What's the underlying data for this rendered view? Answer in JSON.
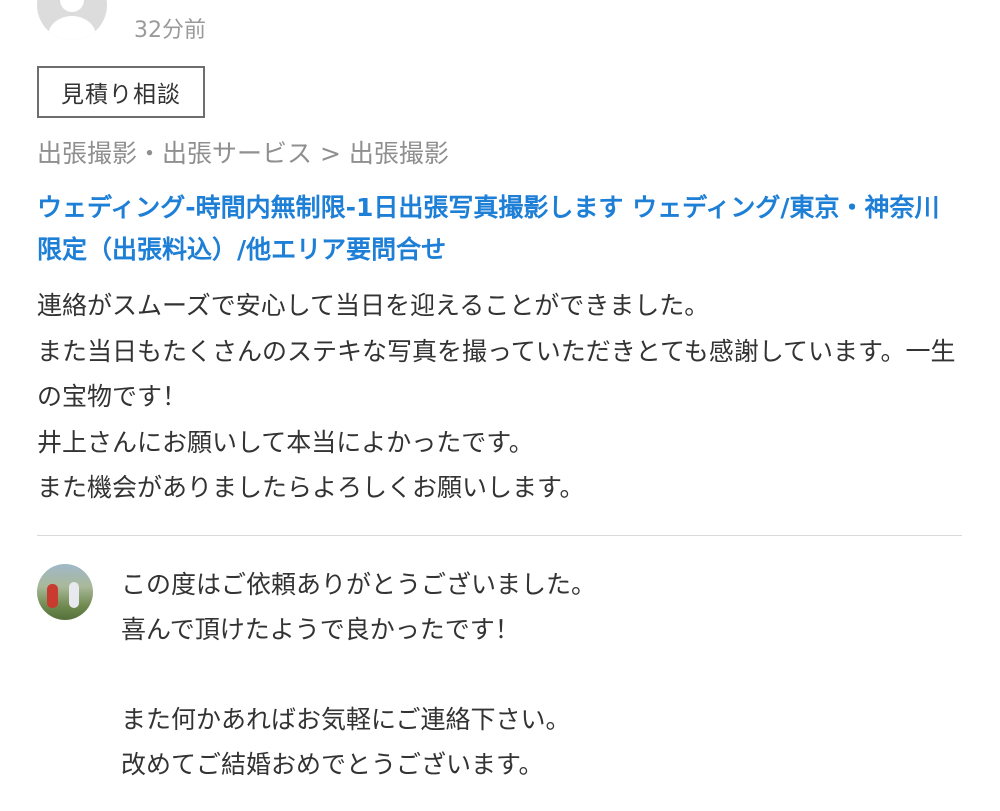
{
  "review": {
    "avatar_icon": "default-user-icon",
    "time_ago": "32分前",
    "tag": "見積り相談",
    "breadcrumb": "出張撮影・出張サービス > 出張撮影",
    "service_title": "ウェディング-時間内無制限-1日出張写真撮影します ウェディング/東京・神奈川限定（出張料込）/他エリア要問合せ",
    "body_lines": [
      "連絡がスムーズで安心して当日を迎えることができました。",
      "また当日もたくさんのステキな写真を撮っていただきとても感謝しています。一生の宝物です！",
      "井上さんにお願いして本当によかったです。",
      "また機会がありましたらよろしくお願いします。"
    ]
  },
  "reply": {
    "avatar_icon": "seller-photo-avatar",
    "lines": [
      "この度はご依頼ありがとうございました。",
      "喜んで頂けたようで良かったです！",
      "",
      "また何かあればお気軽にご連絡下さい。",
      "改めてご結婚おめでとうございます。"
    ]
  },
  "colors": {
    "link": "#1e7fd6",
    "muted": "#8f8f8f",
    "text": "#333333",
    "border": "#6e6e6e"
  }
}
